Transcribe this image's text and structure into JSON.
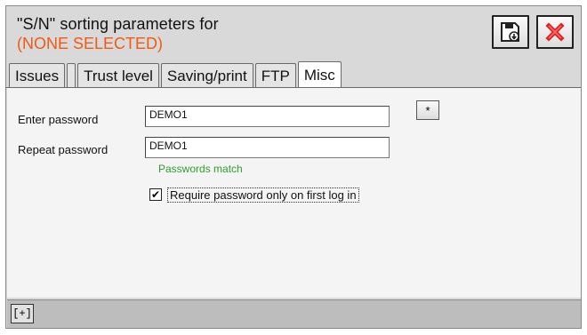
{
  "header": {
    "title": "\"S/N\" sorting parameters for",
    "subtitle": "(NONE SELECTED)",
    "subtitle_color": "#f05a14",
    "save_icon": "save-disk-icon",
    "close_icon": "close-x-icon",
    "close_color": "#e02020"
  },
  "tabs": [
    {
      "label": "Issues",
      "active": false
    },
    {
      "label": "",
      "active": false
    },
    {
      "label": "Trust level",
      "active": false
    },
    {
      "label": "Saving/print",
      "active": false
    },
    {
      "label": "FTP",
      "active": false
    },
    {
      "label": "Misc",
      "active": true
    }
  ],
  "form": {
    "enter_password_label": "Enter password",
    "enter_password_value": "DEMO1",
    "repeat_password_label": "Repeat password",
    "repeat_password_value": "DEMO1",
    "reveal_button_label": "*",
    "match_status": "Passwords match",
    "match_color": "#2e9d2e",
    "require_checkbox_checked": true,
    "require_checkbox_mark": "✔",
    "require_checkbox_label": "Require password only on first log in"
  },
  "bottom": {
    "expand_label": "[+]"
  }
}
